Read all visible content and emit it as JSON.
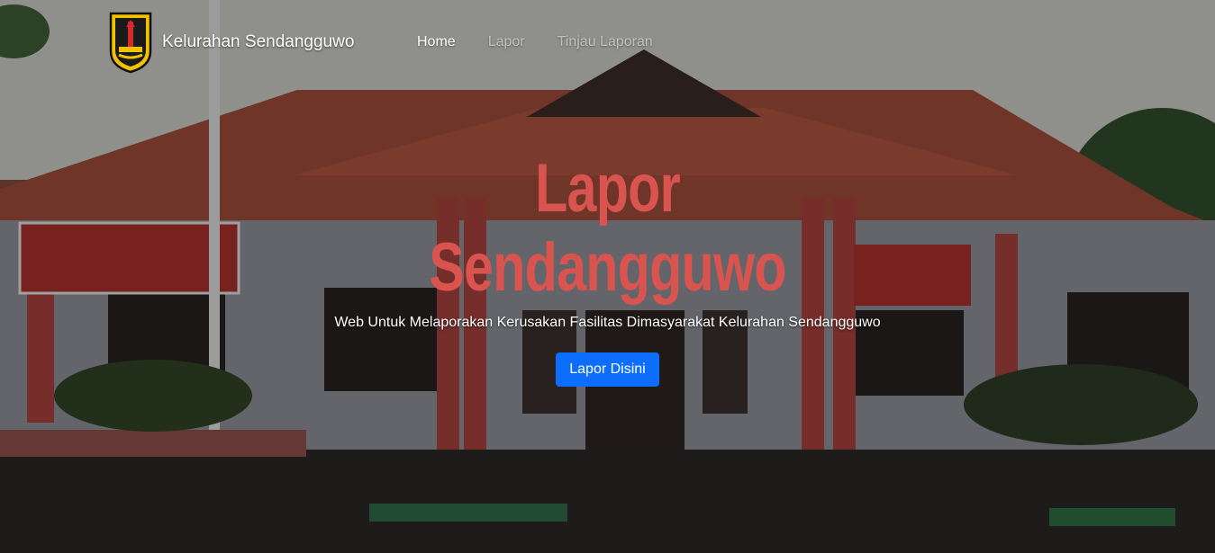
{
  "brand": {
    "name": "Kelurahan Sendangguwo",
    "logo_icon": "city-emblem-icon"
  },
  "nav": {
    "items": [
      {
        "label": "Home",
        "active": true
      },
      {
        "label": "Lapor",
        "active": false
      },
      {
        "label": "Tinjau Laporan",
        "active": false
      }
    ]
  },
  "hero": {
    "title_line1": "Lapor",
    "title_line2": "Sendangguwo",
    "subtitle": "Web Untuk Melaporakan Kerusakan Fasilitas Dimasyarakat Kelurahan Sendangguwo",
    "cta_label": "Lapor Disini"
  },
  "colors": {
    "title": "#d9534f",
    "cta": "#0d6efd",
    "roof": "#b5533e",
    "pillar": "#c24a43"
  }
}
